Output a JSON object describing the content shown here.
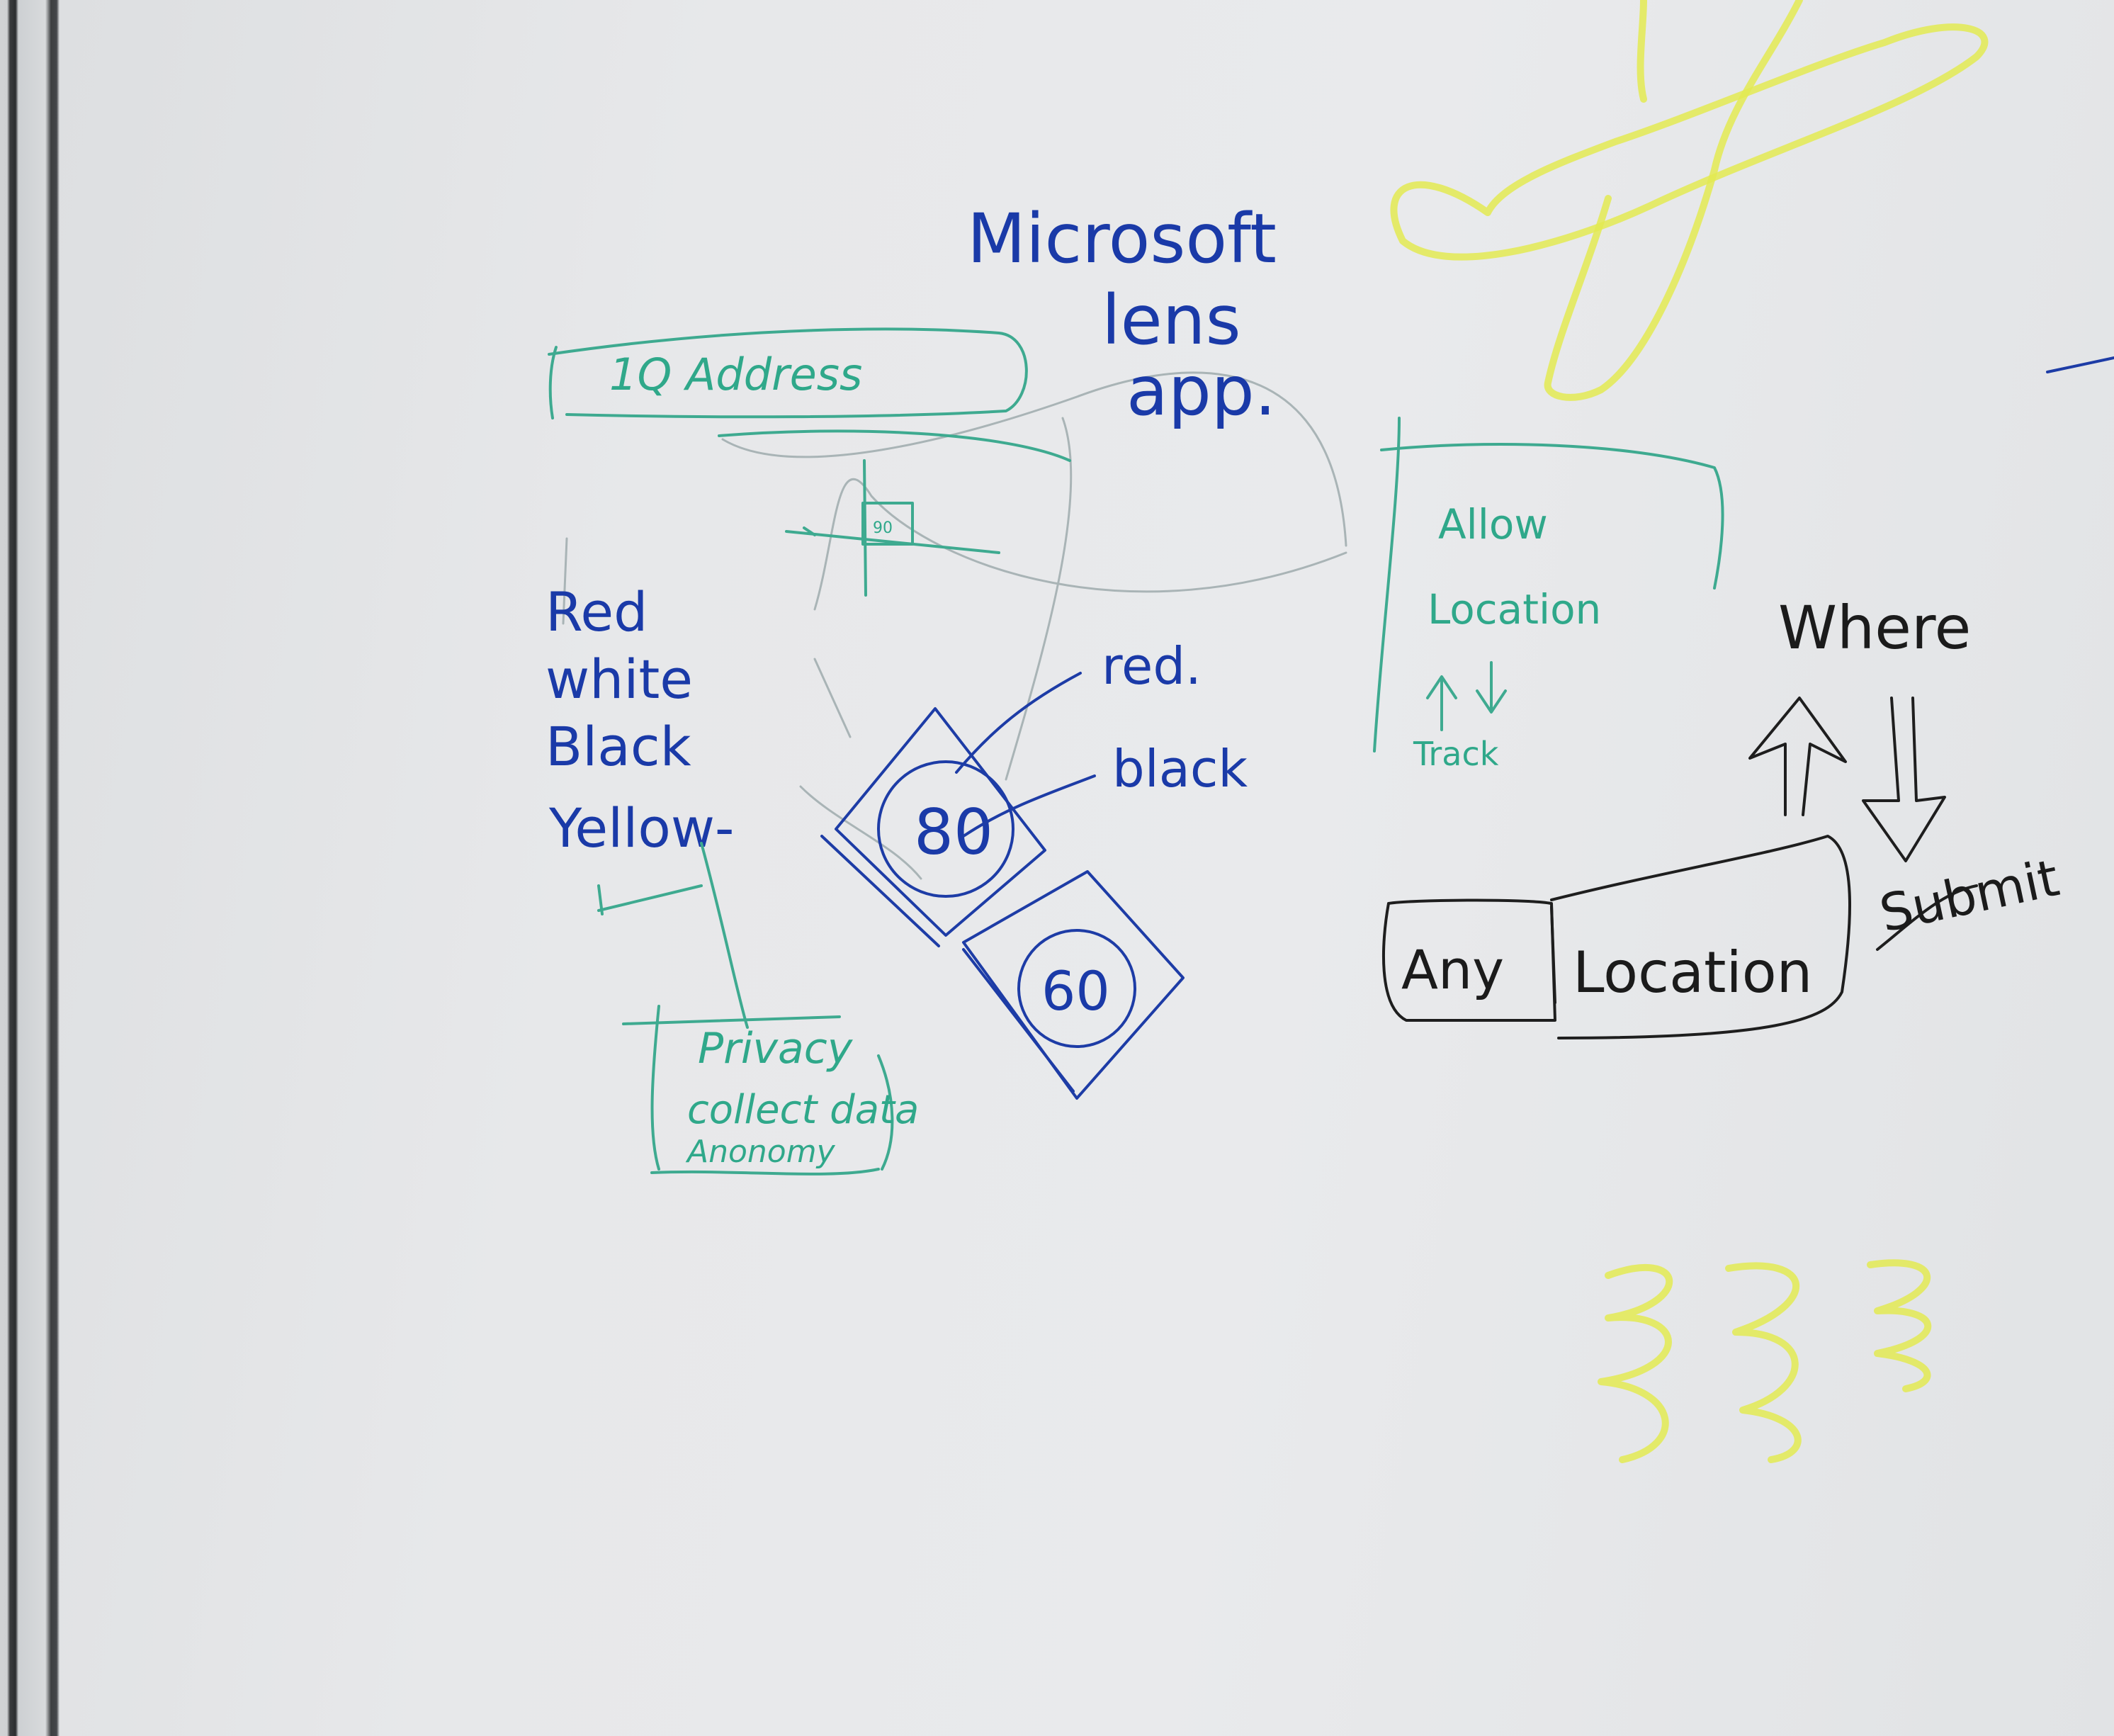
{
  "title_lines": [
    "Microsoft",
    "lens",
    "app."
  ],
  "address_bar": {
    "label": "1Q Address"
  },
  "colors_list": [
    "Red",
    "white",
    "Black",
    "Yellow-"
  ],
  "privacy_note": [
    "Privacy",
    "collect data",
    "Anonomy"
  ],
  "labels": {
    "red": "red.",
    "black": "black"
  },
  "signs": [
    {
      "value": "80"
    },
    {
      "value": "60"
    }
  ],
  "small_sign": "90",
  "right_panel": [
    "Allow",
    "Location",
    "Track"
  ],
  "where_label": "Where",
  "location_box": {
    "left": "Any",
    "right": "Location"
  },
  "submit_label": "Submit",
  "palette": {
    "blue_ink": "#1a3aa8",
    "teal_ink": "#2fa88a",
    "black_ink": "#1b1b1b",
    "yellow_ink": "#e3ea52"
  }
}
